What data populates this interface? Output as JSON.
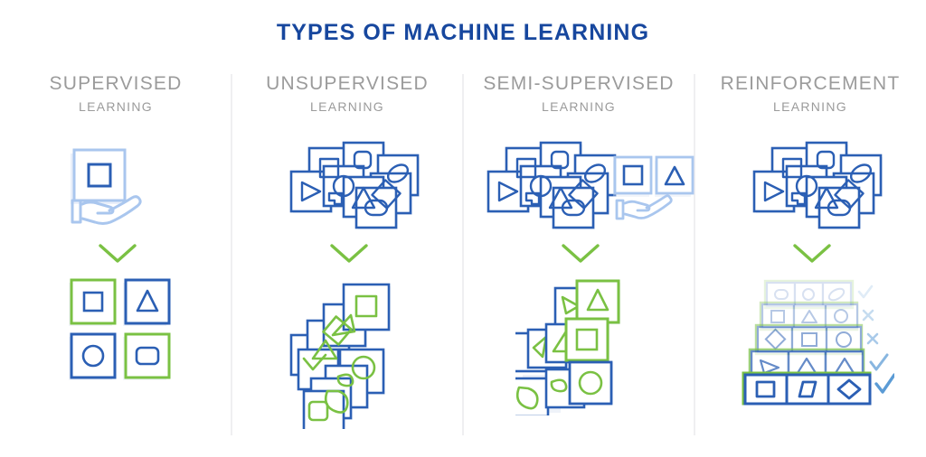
{
  "title": "TYPES OF MACHINE LEARNING",
  "colors": {
    "title_blue": "#17479E",
    "brand_blue": "#2B5FB4",
    "light_blue": "#A9C6EE",
    "mid_blue": "#7FA9E2",
    "green": "#7AC143",
    "header_gray": "#9B9B9B",
    "divider_gray": "#EFEFF1",
    "shadow": "#DCE4F2",
    "background": "#FFFFFF"
  },
  "columns": [
    {
      "id": "supervised",
      "heading_line1": "SUPERVISED",
      "heading_line2": "LEARNING",
      "input_description": "labeled-card-with-hand",
      "input_shapes": [
        "square"
      ],
      "output_description": "grid-of-labeled-cards",
      "output_cards": [
        {
          "shape": "square",
          "border": "green"
        },
        {
          "shape": "triangle",
          "border": "blue"
        },
        {
          "shape": "circle",
          "border": "blue"
        },
        {
          "shape": "rounded-rect",
          "border": "green"
        }
      ],
      "arrow": "chevron-down"
    },
    {
      "id": "unsupervised",
      "heading_line1": "UNSUPERVISED",
      "heading_line2": "LEARNING",
      "input_description": "unlabeled-card-cluster",
      "input_shapes": [
        "triangle",
        "circle",
        "square",
        "diamond",
        "oval",
        "arrow",
        "rounded-square"
      ],
      "output_description": "two-diagonal-clusters-green-shapes",
      "output_clusters": [
        {
          "shapes": [
            "square",
            "arrow",
            "diamond",
            "triangle",
            "arrow"
          ]
        },
        {
          "shapes": [
            "circle",
            "bean",
            "bean",
            "rounded-square"
          ]
        }
      ],
      "arrow": "chevron-down"
    },
    {
      "id": "semi-supervised",
      "heading_line1": "SEMI-SUPERVISED",
      "heading_line2": "LEARNING",
      "input_description": "unlabeled-cluster-plus-two-labeled-cards-with-hand",
      "input_shapes": [
        "triangle",
        "circle",
        "square",
        "diamond",
        "oval",
        "arrow",
        "rounded-square"
      ],
      "labeled_examples": [
        "square",
        "triangle"
      ],
      "output_description": "three-clusters-each-led-by-green-labeled-card",
      "output_clusters": [
        {
          "label_shape": "triangle",
          "label_border": "green"
        },
        {
          "label_shape": "square",
          "label_border": "green"
        },
        {
          "label_shape": "circle",
          "label_border": "green"
        }
      ],
      "arrow": "chevron-down"
    },
    {
      "id": "reinforcement",
      "heading_line1": "REINFORCEMENT",
      "heading_line2": "LEARNING",
      "input_description": "unlabeled-card-cluster",
      "input_shapes": [
        "triangle",
        "circle",
        "square",
        "diamond",
        "oval",
        "arrow",
        "rounded-square"
      ],
      "output_description": "stacked-attempt-rows-with-check-and-cross-marks",
      "output_rows": [
        {
          "shapes": [
            "oval",
            "circle",
            "oval"
          ],
          "mark": "check",
          "opacity": 0.18
        },
        {
          "shapes": [
            "square",
            "triangle",
            "circle"
          ],
          "mark": "cross",
          "opacity": 0.32
        },
        {
          "shapes": [
            "diamond",
            "square",
            "circle"
          ],
          "mark": "cross",
          "opacity": 0.5
        },
        {
          "shapes": [
            "arrow",
            "triangle",
            "triangle"
          ],
          "mark": "check",
          "opacity": 0.7
        },
        {
          "shapes": [
            "square",
            "parallelogram",
            "diamond"
          ],
          "mark": "check",
          "opacity": 1.0
        }
      ],
      "arrow": "chevron-down"
    }
  ]
}
